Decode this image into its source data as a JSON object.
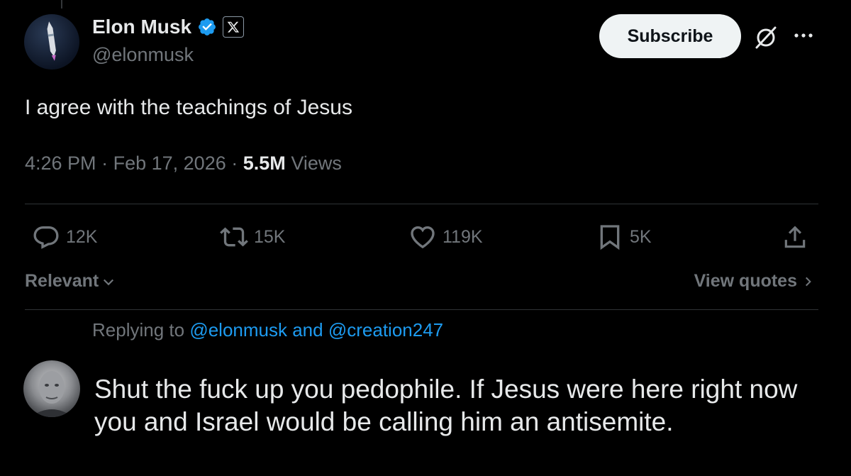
{
  "tweet": {
    "author_name": "Elon Musk",
    "author_handle": "@elonmusk",
    "affiliation_badge": "X",
    "subscribe_label": "Subscribe",
    "text": "I agree with the teachings of Jesus",
    "time": "4:26 PM",
    "separator": "·",
    "date": "Feb 17, 2026",
    "views_count": "5.5M",
    "views_label": "Views"
  },
  "actions": {
    "replies": "12K",
    "reposts": "15K",
    "likes": "119K",
    "bookmarks": "5K"
  },
  "sort": {
    "label": "Relevant"
  },
  "quotes": {
    "label": "View quotes"
  },
  "reply": {
    "replying_to_prefix": "Replying to",
    "mention_1": "@elonmusk",
    "conjunction": "and",
    "mention_2": "@creation247",
    "text": "Shut the fuck up you pedophile. If Jesus were here right now you and Israel would be calling him an antisemite."
  },
  "colors": {
    "background": "#000000",
    "text_primary": "#e7e9ea",
    "text_secondary": "#71767b",
    "accent_blue": "#1d9bf0",
    "divider": "#2f3336"
  },
  "icons": [
    "verified-badge-icon",
    "x-logo-icon",
    "grok-icon",
    "more-icon",
    "reply-icon",
    "repost-icon",
    "like-icon",
    "bookmark-icon",
    "share-icon",
    "chevron-down-icon",
    "chevron-right-icon"
  ]
}
